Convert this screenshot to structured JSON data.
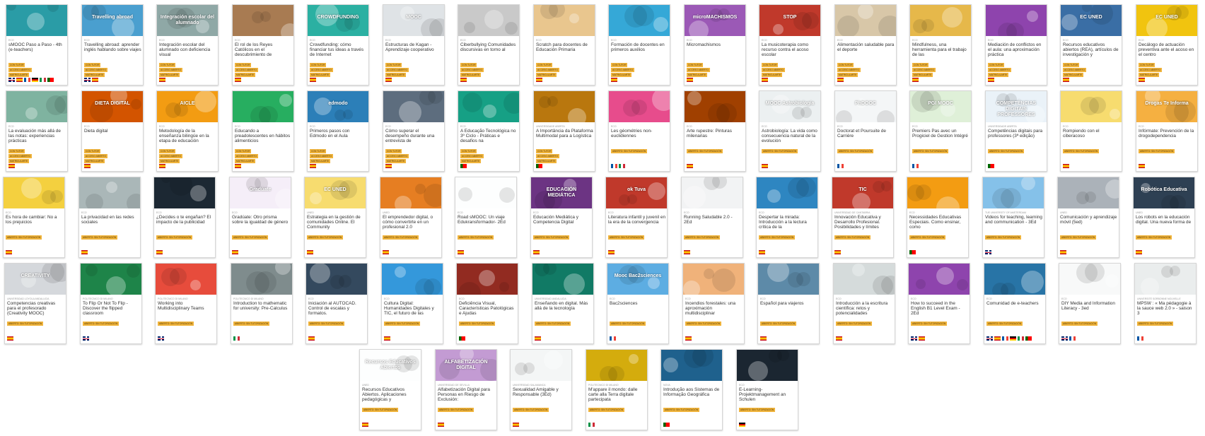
{
  "badges": {
    "open": "ABIERTO: SIN TUTORIZACIÓN",
    "tutor": "CON TUTOR",
    "free": "ACCESO ABIERTO",
    "reg": "MATRICULARTE"
  },
  "cards": [
    {
      "title": "sMOOC Paso a Paso - 4th (e-teachers)",
      "org": "ECO",
      "thumb": "#2a9ca6",
      "thumb_label": "",
      "badges": [
        "CON TUTOR",
        "ACCESO ABIERTO",
        "MATRICULARTE"
      ],
      "flags": [
        "gb",
        "es",
        "fr",
        "de",
        "it",
        "pt"
      ]
    },
    {
      "title": "Travelling abroad: aprender inglés hablando sobre viajes",
      "org": "ECO",
      "thumb": "#4a9fcf",
      "thumb_label": "Travelling abroad",
      "badges": [
        "CON TUTOR",
        "ACCESO ABIERTO",
        "MATRICULARTE"
      ],
      "flags": [
        "gb",
        "es"
      ]
    },
    {
      "title": "Integración escolar del alumnado con deficiencia visual",
      "org": "ECO",
      "thumb": "#8fa8a6",
      "thumb_label": "Integración escolar del alumnado",
      "badges": [
        "CON TUTOR",
        "ACCESO ABIERTO",
        "MATRICULARTE"
      ],
      "flags": [
        "es"
      ]
    },
    {
      "title": "El rol de los Reyes Católicos en el descubrimiento de",
      "org": "ECO",
      "thumb": "#a87b52",
      "thumb_label": "",
      "badges": [
        "CON TUTOR",
        "ACCESO ABIERTO",
        "MATRICULARTE"
      ],
      "flags": [
        "es"
      ]
    },
    {
      "title": "Crowdfunding: cómo financiar tus ideas a través de Internet",
      "org": "ECO",
      "thumb": "#2bb0a2",
      "thumb_label": "CROWDFUNDING",
      "badges": [
        "CON TUTOR",
        "ACCESO ABIERTO",
        "MATRICULARTE"
      ],
      "flags": [
        "es"
      ]
    },
    {
      "title": "Estructuras de Kagan - Aprendizaje cooperativo",
      "org": "ECO",
      "thumb": "#dfe3e6",
      "thumb_label": "MOOC",
      "badges": [
        "CON TUTOR",
        "ACCESO ABIERTO",
        "MATRICULARTE"
      ],
      "flags": [
        "es"
      ]
    },
    {
      "title": "Ciberbullying Comunidades discursivas en torno al",
      "org": "ECO",
      "thumb": "#c9c9c9",
      "thumb_label": "",
      "badges": [
        "CON TUTOR",
        "ACCESO ABIERTO",
        "MATRICULARTE"
      ],
      "flags": [
        "es"
      ]
    },
    {
      "title": "Scratch para docentes de Educación Primaria",
      "org": "ECO",
      "thumb": "#e9c68e",
      "thumb_label": "",
      "badges": [
        "CON TUTOR",
        "ACCESO ABIERTO",
        "MATRICULARTE"
      ],
      "flags": [
        "es"
      ]
    },
    {
      "title": "Formación de docentes en primeros auxilios",
      "org": "ECO",
      "thumb": "#35a8d7",
      "thumb_label": "",
      "badges": [
        "CON TUTOR",
        "ACCESO ABIERTO",
        "MATRICULARTE"
      ],
      "flags": [
        "es"
      ]
    },
    {
      "title": "Micromachismos",
      "org": "ECO",
      "thumb": "#9b59b6",
      "thumb_label": "microMACHISMOS",
      "badges": [
        "CON TUTOR",
        "ACCESO ABIERTO",
        "MATRICULARTE"
      ],
      "flags": [
        "es"
      ]
    },
    {
      "title": "La musicoterapia como recurso contra el acoso escolar",
      "org": "ECO",
      "thumb": "#c0392b",
      "thumb_label": "STOP",
      "badges": [
        "CON TUTOR",
        "ACCESO ABIERTO",
        "MATRICULARTE"
      ],
      "flags": [
        "es"
      ]
    },
    {
      "title": "Alimentación saludable para el deporte",
      "org": "ECO",
      "thumb": "#d8c7a8",
      "thumb_label": "",
      "badges": [
        "CON TUTOR",
        "ACCESO ABIERTO",
        "MATRICULARTE"
      ],
      "flags": [
        "es"
      ]
    },
    {
      "title": "Mindfulness, una herramienta para el trabajo de las",
      "org": "ECO",
      "thumb": "#e6b84a",
      "thumb_label": "",
      "badges": [
        "CON TUTOR",
        "ACCESO ABIERTO",
        "MATRICULARTE"
      ],
      "flags": [
        "es"
      ]
    },
    {
      "title": "Mediación de conflictos en el aula: una aproximación práctica",
      "org": "ECO",
      "thumb": "#8e44ad",
      "thumb_label": "",
      "badges": [
        "CON TUTOR",
        "ACCESO ABIERTO",
        "MATRICULARTE"
      ],
      "flags": [
        "es"
      ]
    },
    {
      "title": "Recursos educativos abiertos (REA), artículos de investigación y",
      "org": "ECO",
      "thumb": "#3a6ea5",
      "thumb_label": "EC UNED",
      "badges": [
        "CON TUTOR",
        "ACCESO ABIERTO",
        "MATRICULARTE"
      ],
      "flags": [
        "es"
      ]
    },
    {
      "title": "Decálogo de actuación preventiva ante el acoso en el centro",
      "org": "ECO",
      "thumb": "#f1c40f",
      "thumb_label": "EC UNED",
      "badges": [
        "CON TUTOR",
        "ACCESO ABIERTO",
        "MATRICULARTE"
      ],
      "flags": [
        "es"
      ]
    },
    {
      "title": "La evaluación más allá de las notas: experiencias prácticas",
      "org": "ECO",
      "thumb": "#7fb3a0",
      "thumb_label": "",
      "badges": [
        "CON TUTOR",
        "ACCESO ABIERTO",
        "MATRICULARTE"
      ],
      "flags": [
        "es"
      ]
    },
    {
      "title": "Dieta digital",
      "org": "ECO",
      "thumb": "#d35400",
      "thumb_label": "DIETA DIGITAL",
      "badges": [
        "CON TUTOR",
        "ACCESO ABIERTO",
        "MATRICULARTE"
      ],
      "flags": [
        "es"
      ]
    },
    {
      "title": "Metodología de la enseñanza bilingüe en la etapa de educación",
      "org": "ECO",
      "thumb": "#f39c12",
      "thumb_label": "AICLE",
      "badges": [
        "CON TUTOR",
        "ACCESO ABIERTO",
        "MATRICULARTE"
      ],
      "flags": [
        "es"
      ]
    },
    {
      "title": "Educando a preadolescentes en hábitos alimenticios",
      "org": "ECO",
      "thumb": "#27ae60",
      "thumb_label": "",
      "badges": [
        "CON TUTOR",
        "ACCESO ABIERTO",
        "MATRICULARTE"
      ],
      "flags": [
        "es"
      ]
    },
    {
      "title": "Primeros pasos con Edmodo en el Aula",
      "org": "ECO",
      "thumb": "#2c7fb8",
      "thumb_label": "edmodo",
      "badges": [
        "CON TUTOR",
        "ACCESO ABIERTO",
        "MATRICULARTE"
      ],
      "flags": [
        "es"
      ]
    },
    {
      "title": "Cómo superar el desempeño durante una entrevista de",
      "org": "ECO",
      "thumb": "#5d6d7e",
      "thumb_label": "",
      "badges": [
        "CON TUTOR",
        "ACCESO ABIERTO",
        "MATRICULARTE"
      ],
      "flags": [
        "es"
      ]
    },
    {
      "title": "A Educação Tecnológica no 3º Ciclo - Práticas e desafios na",
      "org": "ECO",
      "thumb": "#16a085",
      "thumb_label": "",
      "badges": [
        "CON TUTOR",
        "ACCESO ABIERTO",
        "MATRICULARTE"
      ],
      "flags": [
        "pt"
      ]
    },
    {
      "title": "A Importância da Plataforma Multimodal para a Logística",
      "org": "UNIVERSIDADE ABERTA",
      "thumb": "#b9770e",
      "thumb_label": "",
      "badges": [
        "CON TUTOR",
        "ACCESO ABIERTO",
        "MATRICULARTE"
      ],
      "flags": [
        "pt"
      ]
    },
    {
      "title": "Les géométries non-euclidiennes",
      "org": "ECO",
      "thumb": "#e74c8c",
      "thumb_label": "",
      "badges": [
        "ABIERTO: SIN TUTORIZACIÓN"
      ],
      "flags": [
        "fr",
        "it"
      ]
    },
    {
      "title": "Arte rupestre: Pinturas milenarias",
      "org": "ECO",
      "thumb": "#a04000",
      "thumb_label": "",
      "badges": [
        "ABIERTO: SIN TUTORIZACIÓN"
      ],
      "flags": [
        "es"
      ]
    },
    {
      "title": "Astrobiología: La vida como consecuencia natural de la evolución",
      "org": "ECO",
      "thumb": "#ecf0f1",
      "thumb_label": "MOOC Astrobiología",
      "badges": [
        "ABIERTO: SIN TUTORIZACIÓN"
      ],
      "flags": [
        "es"
      ]
    },
    {
      "title": "Doctorat et Poursuite de Carrière",
      "org": "ECO",
      "thumb": "#f4f6f7",
      "thumb_label": "PhDOOC",
      "badges": [
        "ABIERTO: SIN TUTORIZACIÓN"
      ],
      "flags": [
        "fr"
      ]
    },
    {
      "title": "Premiers Pas avec un Progiciel de Gestion Intégré",
      "org": "ECO",
      "thumb": "#dff0d8",
      "thumb_label": "PGI MOOC",
      "badges": [
        "ABIERTO: SIN TUTORIZACIÓN"
      ],
      "flags": [
        "fr"
      ]
    },
    {
      "title": "Competências digitais para professores (3ª edição)",
      "org": "UNIVERSIDADE ABERTA",
      "thumb": "#eaf2f8",
      "thumb_label": "COMPETÊNCIAS DIGITAIS PROFESSORES",
      "badges": [
        "ABIERTO: SIN TUTORIZACIÓN"
      ],
      "flags": [
        "pt"
      ]
    },
    {
      "title": "Rompiendo con el ciberacoso",
      "org": "ECO",
      "thumb": "#f7dc6f",
      "thumb_label": "",
      "badges": [
        "ABIERTO: SIN TUTORIZACIÓN"
      ],
      "flags": [
        "es"
      ]
    },
    {
      "title": "Infórmate: Prevención de la drogodependencia",
      "org": "ECO",
      "thumb": "#f5b041",
      "thumb_label": "Drogas Te Informa",
      "badges": [
        "ABIERTO: SIN TUTORIZACIÓN"
      ],
      "flags": [
        "es"
      ]
    },
    {
      "title": "Es hora de cambiar: No a los prejuicios",
      "org": "ECO",
      "thumb": "#f4d03f",
      "thumb_label": "",
      "badges": [
        "ABIERTO: SIN TUTORIZACIÓN"
      ],
      "flags": [
        "es"
      ]
    },
    {
      "title": "La privacidad en las redes sociales",
      "org": "ECO",
      "thumb": "#aab7b8",
      "thumb_label": "",
      "badges": [
        "ABIERTO: SIN TUTORIZACIÓN"
      ],
      "flags": [
        "es"
      ]
    },
    {
      "title": "¿Decides o te engañan? El impacto de la publicidad",
      "org": "ECO",
      "thumb": "#1c2833",
      "thumb_label": "",
      "badges": [
        "ABIERTO: SIN TUTORIZACIÓN"
      ],
      "flags": [
        "es"
      ]
    },
    {
      "title": "Gradúate: Otro prisma sobre la igualdad de género",
      "org": "ECO",
      "thumb": "#f5eef8",
      "thumb_label": "Gradúate",
      "badges": [
        "ABIERTO: SIN TUTORIZACIÓN"
      ],
      "flags": [
        "es"
      ]
    },
    {
      "title": "Estrategia en la gestión de comunidades Online. El Community",
      "org": "UNED",
      "thumb": "#f7dc6f",
      "thumb_label": "EC UNED",
      "badges": [
        "ABIERTO: SIN TUTORIZACIÓN"
      ],
      "flags": [
        "es"
      ]
    },
    {
      "title": "El emprendedor digital, o cómo convertirte en un profesional 2.0",
      "org": "UNED",
      "thumb": "#e67e22",
      "thumb_label": "",
      "badges": [
        "ABIERTO: SIN TUTORIZACIÓN"
      ],
      "flags": [
        "es"
      ]
    },
    {
      "title": "Road sMOOC: Un viaje Edukransformador- 2Ed",
      "org": "ECO",
      "thumb": "#fdfefe",
      "thumb_label": "",
      "badges": [
        "ABIERTO: SIN TUTORIZACIÓN"
      ],
      "flags": [
        "es"
      ]
    },
    {
      "title": "Educación Mediática y Competencia Digital",
      "org": "ECO",
      "thumb": "#6c3483",
      "thumb_label": "EDUCACIÓN MEDIÁTICA",
      "badges": [
        "ABIERTO: SIN TUTORIZACIÓN"
      ],
      "flags": [
        "es"
      ]
    },
    {
      "title": "Literatura infantil y juvenil en la era de la convergencia",
      "org": "ECO",
      "thumb": "#c0392b",
      "thumb_label": "ok Tuva",
      "badges": [
        "ABIERTO: SIN TUTORIZACIÓN"
      ],
      "flags": [
        "es"
      ]
    },
    {
      "title": "Running Saludable 2.0 - 2Ed",
      "org": "ECO",
      "thumb": "#f2f3f4",
      "thumb_label": "",
      "badges": [
        "ABIERTO: SIN TUTORIZACIÓN"
      ],
      "flags": [
        "es"
      ]
    },
    {
      "title": "Despertar la mirada: Introducción a la lectura crítica de la",
      "org": "ECO",
      "thumb": "#2e86c1",
      "thumb_label": "",
      "badges": [
        "ABIERTO: SIN TUTORIZACIÓN"
      ],
      "flags": [
        "es"
      ]
    },
    {
      "title": "Innovación Educativa y Desarrollo Profesional. Posibilidades y límites",
      "org": "UNIVERSIDAD DE CANTABRIA",
      "thumb": "#c0392b",
      "thumb_label": "TIC",
      "badges": [
        "ABIERTO: SIN TUTORIZACIÓN"
      ],
      "flags": [
        "es"
      ]
    },
    {
      "title": "Necessidades Educativas Especiais. Como ensinar, como",
      "org": "ECO",
      "thumb": "#f39c12",
      "thumb_label": "",
      "badges": [
        "ABIERTO: SIN TUTORIZACIÓN"
      ],
      "flags": [
        "pt"
      ]
    },
    {
      "title": "Videos for teaching, learning and communication - 3Ed",
      "org": "TUE UNIVERSITY OF AMSTERDAM",
      "thumb": "#85c1e9",
      "thumb_label": "",
      "badges": [
        "ABIERTO: SIN TUTORIZACIÓN"
      ],
      "flags": [
        "gb"
      ]
    },
    {
      "title": "Comunicación y aprendizaje móvil (5ed)",
      "org": "UNED",
      "thumb": "#abb2b9",
      "thumb_label": "",
      "badges": [
        "ABIERTO: SIN TUTORIZACIÓN"
      ],
      "flags": [
        "es"
      ]
    },
    {
      "title": "Los robots en la educación digital. Una nueva forma de",
      "org": "UNED",
      "thumb": "#2e4053",
      "thumb_label": "Robótica Educativa",
      "badges": [
        "ABIERTO: SIN TUTORIZACIÓN"
      ],
      "flags": [
        "es"
      ]
    },
    {
      "title": "Competencias creativas para el profesorado (Creativity MOOC)",
      "org": "UNIVERSIDAD LOYOLA ANDALUCÍA",
      "thumb": "#d5d8dc",
      "thumb_label": "CREATIVITY",
      "badges": [
        "ABIERTO: SIN TUTORIZACIÓN"
      ],
      "flags": [
        "es"
      ]
    },
    {
      "title": "To Flip Or Not To Flip - Discover the flipped classroom",
      "org": "POLITECNICO DI MILANO",
      "thumb": "#1e8449",
      "thumb_label": "",
      "badges": [
        "ABIERTO: SIN TUTORIZACIÓN"
      ],
      "flags": [
        "gb"
      ]
    },
    {
      "title": "Working into Multidisciplinary Teams",
      "org": "POLITECNICO DI MILANO",
      "thumb": "#e74c3c",
      "thumb_label": "",
      "badges": [
        "ABIERTO: SIN TUTORIZACIÓN"
      ],
      "flags": [
        "gb"
      ]
    },
    {
      "title": "Introduction to mathematic for university: Pre-Calculus",
      "org": "POLITECNICO DI MILANO",
      "thumb": "#7f8c8d",
      "thumb_label": "",
      "badges": [
        "ABIERTO: SIN TUTORIZACIÓN"
      ],
      "flags": [
        "it"
      ]
    },
    {
      "title": "Iniciación al AUTOCAD. Control de escalas y formatos.",
      "org": "ECO",
      "thumb": "#34495e",
      "thumb_label": "",
      "badges": [
        "ABIERTO: SIN TUTORIZACIÓN"
      ],
      "flags": [
        "es"
      ]
    },
    {
      "title": "Cultura Digital: Humanidades Digitales y TIC, el futuro de las",
      "org": "ECO",
      "thumb": "#3498db",
      "thumb_label": "",
      "badges": [
        "ABIERTO: SIN TUTORIZACIÓN"
      ],
      "flags": [
        "es"
      ]
    },
    {
      "title": "Deficiência Visual, Características Patológicas e Ajudas",
      "org": "ECO",
      "thumb": "#922b21",
      "thumb_label": "",
      "badges": [
        "ABIERTO: SIN TUTORIZACIÓN"
      ],
      "flags": [
        "pt"
      ]
    },
    {
      "title": "Enseñando en digital. Más allá de la tecnología",
      "org": "UNIVERSIDAD ANDALUCÍA",
      "thumb": "#117a65",
      "thumb_label": "",
      "badges": [
        "ABIERTO: SIN TUTORIZACIÓN"
      ],
      "flags": [
        "es"
      ]
    },
    {
      "title": "Bac2sciences",
      "org": "ECO",
      "thumb": "#5dade2",
      "thumb_label": "Mooc Bac2sciences",
      "badges": [
        "ABIERTO: SIN TUTORIZACIÓN"
      ],
      "flags": [
        "fr"
      ]
    },
    {
      "title": "Incendios forestales: una aproximación multidisciplinar",
      "org": "ECO",
      "thumb": "#f0b27a",
      "thumb_label": "",
      "badges": [
        "ABIERTO: SIN TUTORIZACIÓN"
      ],
      "flags": [
        "es"
      ]
    },
    {
      "title": "Español para viajeros",
      "org": "ECO",
      "thumb": "#5d8aa8",
      "thumb_label": "",
      "badges": [
        "ABIERTO: SIN TUTORIZACIÓN"
      ],
      "flags": [
        "es"
      ]
    },
    {
      "title": "Introducción a la escritura científica: retos y potencialidades",
      "org": "ECO",
      "thumb": "#d5dbdb",
      "thumb_label": "",
      "badges": [
        "ABIERTO: SIN TUTORIZACIÓN"
      ],
      "flags": [
        "es"
      ]
    },
    {
      "title": "How to succeed in the English B1 Level Exam - 2Ed",
      "org": "ECO",
      "thumb": "#8e44ad",
      "thumb_label": "",
      "badges": [
        "ABIERTO: SIN TUTORIZACIÓN"
      ],
      "flags": [
        "gb",
        "es"
      ]
    },
    {
      "title": "Comunidad de e-teachers",
      "org": "ECO",
      "thumb": "#2874a6",
      "thumb_label": "",
      "badges": [
        "ABIERTO: SIN TUTORIZACIÓN"
      ],
      "flags": [
        "gb",
        "es",
        "fr",
        "de",
        "it",
        "pt"
      ]
    },
    {
      "title": "DIY Media and Information Literacy - 3ed",
      "org": "ECO",
      "thumb": "#f8f9f9",
      "thumb_label": "",
      "badges": [
        "ABIERTO: SIN TUTORIZACIÓN"
      ],
      "flags": [
        "gb",
        "fr"
      ]
    },
    {
      "title": "MPSW : « Ma pédagogie à la sauce web 2.0 » - saison 3",
      "org": "UNIVERSITÉ SORBONNE NOUVELLE",
      "thumb": "#eaeded",
      "thumb_label": "",
      "badges": [
        "ABIERTO: SIN TUTORIZACIÓN"
      ],
      "flags": [
        "fr"
      ]
    },
    {
      "title": "Recursos Educativos Abiertos. Aplicaciones pedagógicas y",
      "org": "UNED",
      "thumb": "#fdfefe",
      "thumb_label": "Recursos Educativos Abiertos",
      "badges": [
        "ABIERTO: SIN TUTORIZACIÓN"
      ],
      "flags": [
        "es"
      ]
    },
    {
      "title": "Alfabetización Digital para Personas en Riesgo de Exclusión:",
      "org": "UNIVERSIDAD DE SEVILLA",
      "thumb": "#c39bd3",
      "thumb_label": "ALFABETIZACIÓN DIGITAL",
      "badges": [
        "ABIERTO: SIN TUTORIZACIÓN"
      ],
      "flags": [
        "es"
      ]
    },
    {
      "title": "Sexualidad Amigable y Responsable (3Ed)",
      "org": "UNIVERSIDAD SALAMANCA",
      "thumb": "#f4f6f6",
      "thumb_label": "",
      "badges": [
        "ABIERTO: SIN TUTORIZACIÓN"
      ],
      "flags": [
        "es"
      ]
    },
    {
      "title": "M'appare il mondo: dalle carte alla Terra digitale partecipata",
      "org": "POLITECNICO DI MILANO",
      "thumb": "#d4ac0d",
      "thumb_label": "",
      "badges": [
        "ABIERTO: SIN TUTORIZACIÓN"
      ],
      "flags": [
        "it"
      ]
    },
    {
      "title": "Introdução aos Sistemas de Informação Geográfica",
      "org": "NOVA",
      "thumb": "#1f618d",
      "thumb_label": "",
      "badges": [
        "ABIERTO: SIN TUTORIZACIÓN"
      ],
      "flags": [
        "pt"
      ]
    },
    {
      "title": "E-Learning-Projektmanagement an Schulen",
      "org": "ECO",
      "thumb": "#1b2631",
      "thumb_label": "",
      "badges": [
        "ABIERTO: SIN TUTORIZACIÓN"
      ],
      "flags": [
        "de"
      ]
    }
  ]
}
